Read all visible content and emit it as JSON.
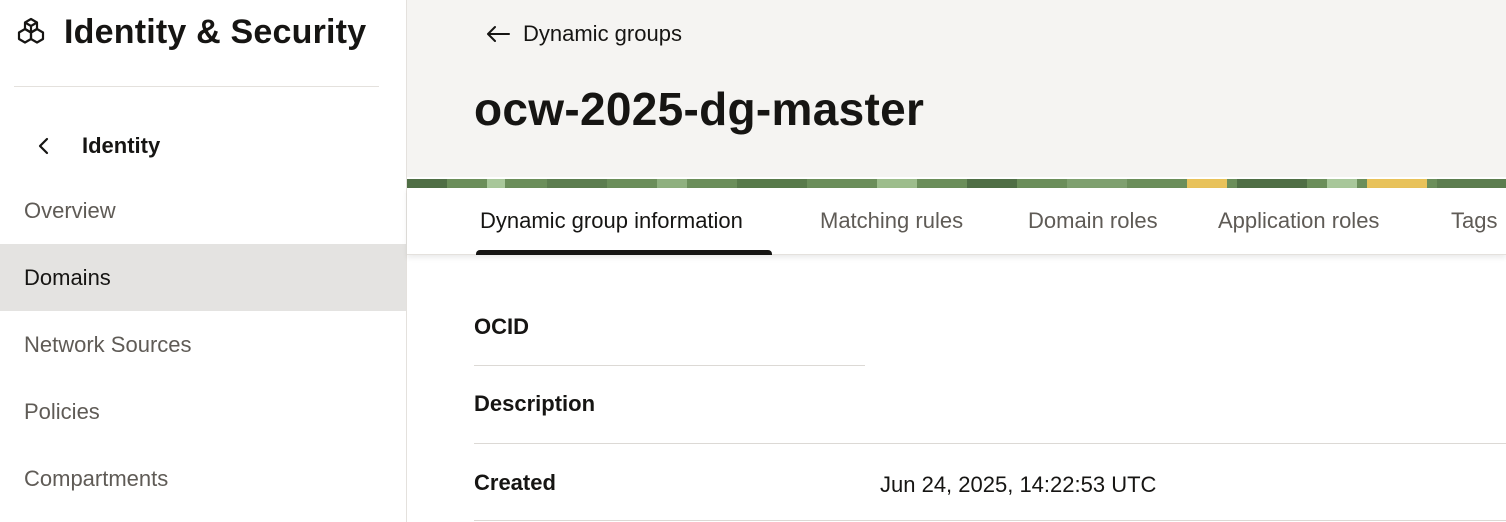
{
  "sidebar": {
    "app_title": "Identity & Security",
    "back_label": "Identity",
    "items": [
      {
        "label": "Overview",
        "active": false
      },
      {
        "label": "Domains",
        "active": true
      },
      {
        "label": "Network Sources",
        "active": false
      },
      {
        "label": "Policies",
        "active": false
      },
      {
        "label": "Compartments",
        "active": false
      }
    ]
  },
  "header": {
    "breadcrumb_label": "Dynamic groups",
    "title": "ocw-2025-dg-master"
  },
  "tabs": [
    {
      "label": "Dynamic group information",
      "active": true
    },
    {
      "label": "Matching rules",
      "active": false
    },
    {
      "label": "Domain roles",
      "active": false
    },
    {
      "label": "Application roles",
      "active": false
    },
    {
      "label": "Tags",
      "active": false
    }
  ],
  "details": {
    "ocid_label": "OCID",
    "ocid_value": "",
    "description_label": "Description",
    "description_value": "",
    "created_label": "Created",
    "created_value": "Jun 24, 2025, 14:22:53 UTC"
  },
  "colors": {
    "header_bg": "#f5f4f2",
    "active_nav_bg": "#e4e3e1",
    "text_primary": "#161513",
    "text_secondary": "#5f5b56",
    "banner_green": "#6b8e5a",
    "banner_yellow": "#e8c25a"
  },
  "icons": {
    "brand": "identity-security-cubes-icon",
    "back": "chevron-left-icon",
    "breadcrumb": "arrow-left-icon"
  }
}
